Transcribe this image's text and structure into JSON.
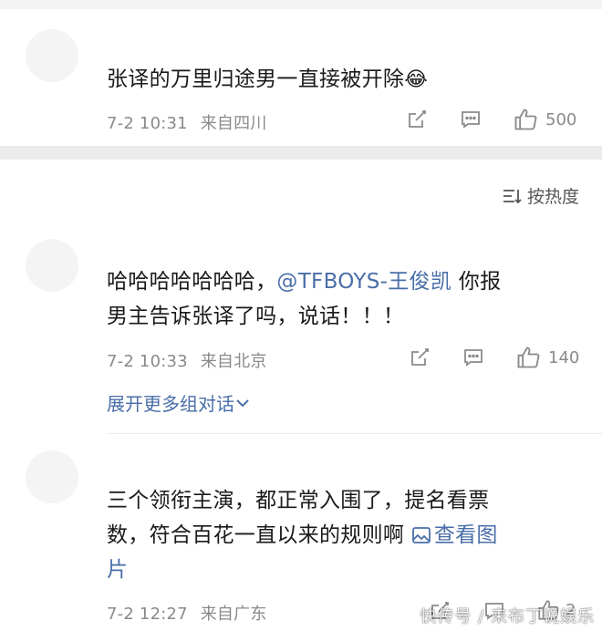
{
  "comments": [
    {
      "text": "张译的万里归途男一直接被开除",
      "emoji": "😂",
      "time": "7-2 10:31",
      "location": "来自四川",
      "likes": "500"
    },
    {
      "text_prefix": "哈哈哈哈哈哈哈，",
      "mention": "@TFBOYS-王俊凯",
      "text_line1_suffix": " 你报",
      "text_line2": "男主告诉张译了吗，说话！！！",
      "time": "7-2 10:33",
      "location": "来自北京",
      "likes": "140",
      "expand_label": "展开更多组对话"
    },
    {
      "text_line1": "三个领衔主演，都正常入围了，提名看票",
      "text_line2_prefix": "数，符合百花一直以来的规则啊 ",
      "view_image_label": "查看图",
      "text_line3": "片",
      "time": "7-2 12:27",
      "location": "来自广东",
      "likes": "2"
    }
  ],
  "sort_label": "按热度",
  "watermark": "快传号 / 来布丁说娱乐",
  "colors": {
    "link": "#4a6ea9",
    "meta": "#8a8a8a",
    "separator": "#ebebeb"
  }
}
